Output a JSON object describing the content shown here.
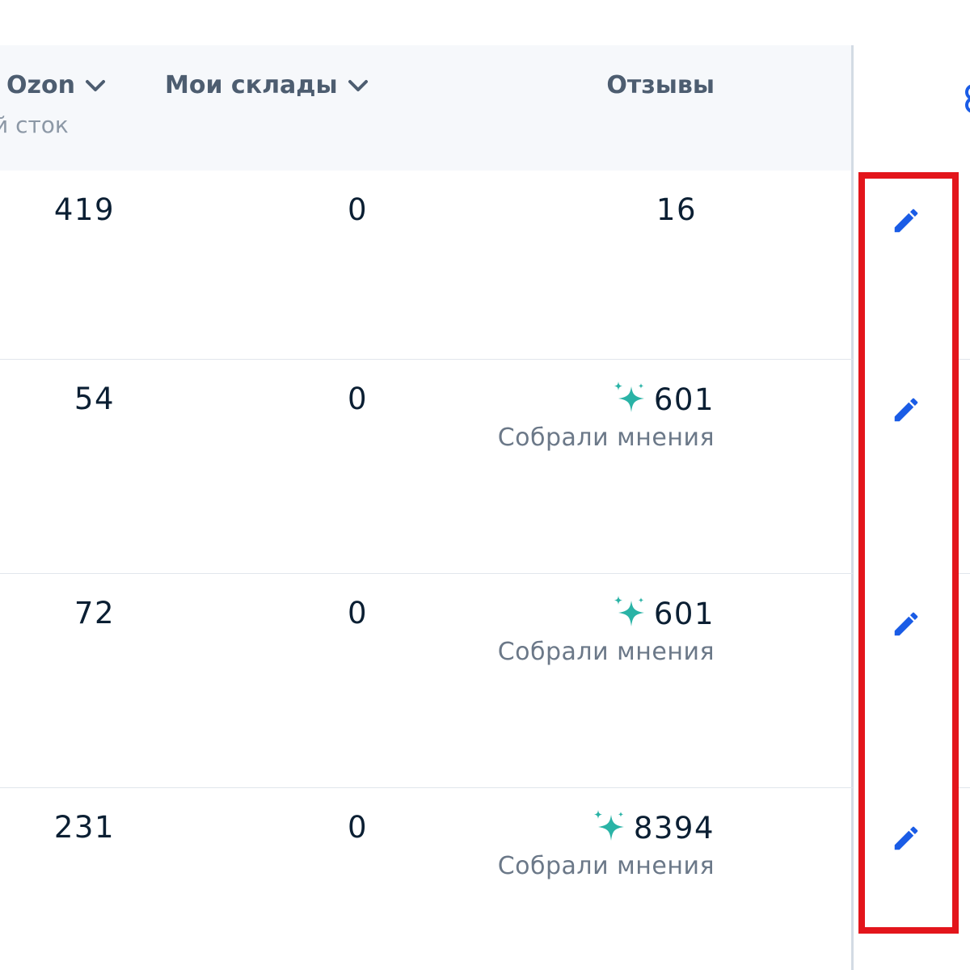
{
  "header": {
    "ozon_col": "Ozon",
    "ozon_sub": "й сток",
    "sklady_col": "Мои склады",
    "reviews_col": "Отзывы"
  },
  "rows": [
    {
      "ozon": "419",
      "sklady": "0",
      "reviews": "16",
      "ai": false,
      "reviews_note": ""
    },
    {
      "ozon": "54",
      "sklady": "0",
      "reviews": "601",
      "ai": true,
      "reviews_note": "Собрали мнения"
    },
    {
      "ozon": "72",
      "sklady": "0",
      "reviews": "601",
      "ai": true,
      "reviews_note": "Собрали мнения"
    },
    {
      "ozon": "231",
      "sklady": "0",
      "reviews": "8394",
      "ai": true,
      "reviews_note": "Собрали мнения"
    }
  ],
  "icons": {
    "edit": "pencil-icon",
    "ai": "sparkle-icon",
    "sort": "chevron-down-icon"
  },
  "colors": {
    "edit_icon": "#1a5ce6",
    "sparkle": "#2ab3a6",
    "highlight": "#e3151b"
  }
}
